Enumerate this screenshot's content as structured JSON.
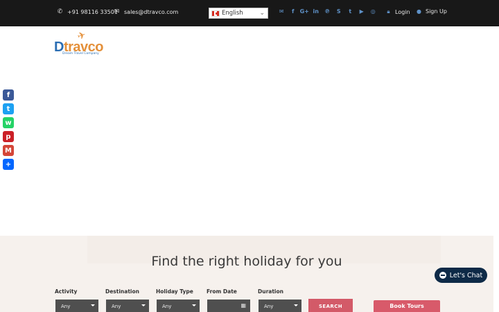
{
  "topbar": {
    "phone": "+91 98116 33501",
    "email": "sales@dtravco.com",
    "language": "English",
    "socials": [
      "envelope-icon",
      "facebook-icon",
      "google-plus-icon",
      "linkedin-icon",
      "pinterest-icon",
      "skype-icon",
      "twitter-icon",
      "youtube-icon",
      "instagram-icon"
    ],
    "login": "Login",
    "signup": "Sign Up"
  },
  "logo": {
    "d": "D",
    "rest": "travco",
    "tagline": "Dream Travel Company"
  },
  "share": [
    {
      "name": "facebook",
      "glyph": "f",
      "color": "#3b5998"
    },
    {
      "name": "twitter",
      "glyph": "t",
      "color": "#1da1f2"
    },
    {
      "name": "whatsapp",
      "glyph": "w",
      "color": "#25d366"
    },
    {
      "name": "pinterest",
      "glyph": "p",
      "color": "#cb2027"
    },
    {
      "name": "gmail",
      "glyph": "M",
      "color": "#d44638"
    },
    {
      "name": "share",
      "glyph": "+",
      "color": "#0166ff"
    }
  ],
  "search": {
    "heading": "Find the right holiday for you",
    "activity_label": "Activity",
    "destination_label": "Destination",
    "holiday_type_label": "Holiday Type",
    "from_date_label": "From Date",
    "duration_label": "Duration",
    "activity_value": "Any",
    "destination_value": "Any",
    "holiday_type_value": "Any",
    "duration_value": "Any",
    "search_button": "SEARCH",
    "book_tours": "Book Tours"
  },
  "chat": {
    "label": "Let's Chat"
  },
  "colors": {
    "accent_blue": "#2b6eb3",
    "accent_orange": "#e4903a",
    "cta_red": "#d35a68",
    "chat_navy": "#0e2a47"
  }
}
